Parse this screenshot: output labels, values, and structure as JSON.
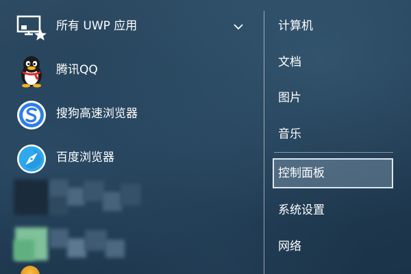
{
  "apps": {
    "all_apps_label": "所有 UWP 应用",
    "items": [
      {
        "label": "腾讯QQ",
        "icon": "qq-penguin-icon"
      },
      {
        "label": "搜狗高速浏览器",
        "icon": "sogou-browser-icon"
      },
      {
        "label": "百度浏览器",
        "icon": "baidu-browser-icon"
      }
    ]
  },
  "places": {
    "items": [
      {
        "label": "计算机"
      },
      {
        "label": "文档"
      },
      {
        "label": "图片"
      },
      {
        "label": "音乐"
      },
      {
        "label": "控制面板",
        "selected": true
      },
      {
        "label": "系统设置"
      },
      {
        "label": "网络"
      }
    ]
  },
  "colors": {
    "background": "#223f57",
    "text": "#ffffff",
    "selection_border": "#ebf5ff",
    "qq_scarf": "#e0281e",
    "sogou_blue": "#2f7ee6",
    "baidu_blue": "#2fa8ef"
  }
}
